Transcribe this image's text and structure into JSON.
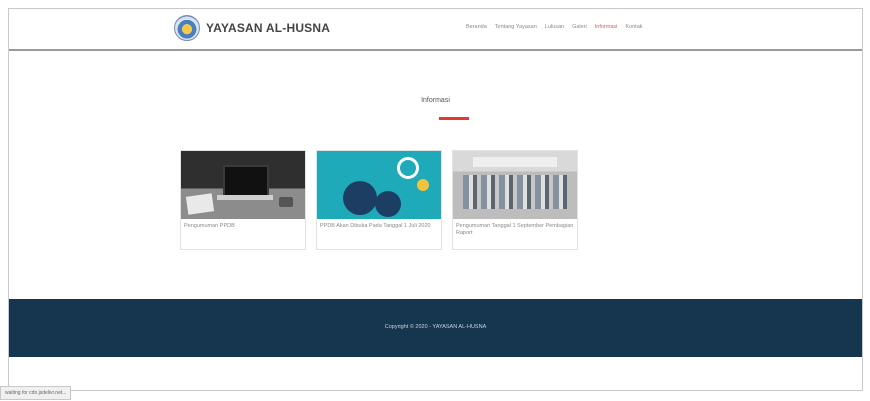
{
  "brand": {
    "name": "YAYASAN AL-HUSNA",
    "logo": "yayasan-emblem-logo"
  },
  "nav": {
    "items": [
      {
        "label": "Beranda"
      },
      {
        "label": "Tentang Yayasan"
      },
      {
        "label": "Lulusan"
      },
      {
        "label": "Galeri"
      },
      {
        "label": "Informasi",
        "active": true
      },
      {
        "label": "Kontak"
      }
    ],
    "active_color": "#e05a5a"
  },
  "section": {
    "title": "Informasi",
    "underline_color": "#e23b2e"
  },
  "cards": [
    {
      "caption": "Pengumuman PPDB",
      "image": "laptop-desk-photo"
    },
    {
      "caption": "PPDB Akan Dibuka Pada Tanggal 1 Juli 2020",
      "image": "gears-illustration"
    },
    {
      "caption": "Pengumuman Tanggal 1 September Pembagian Raport",
      "image": "ceremony-photo"
    }
  ],
  "footer": {
    "text": "Copyright © 2020 - YAYASAN AL-HUSNA",
    "bg_color": "#16354f"
  },
  "statusbar": {
    "text": "waiting for cdn.jsdelivr.net..."
  }
}
